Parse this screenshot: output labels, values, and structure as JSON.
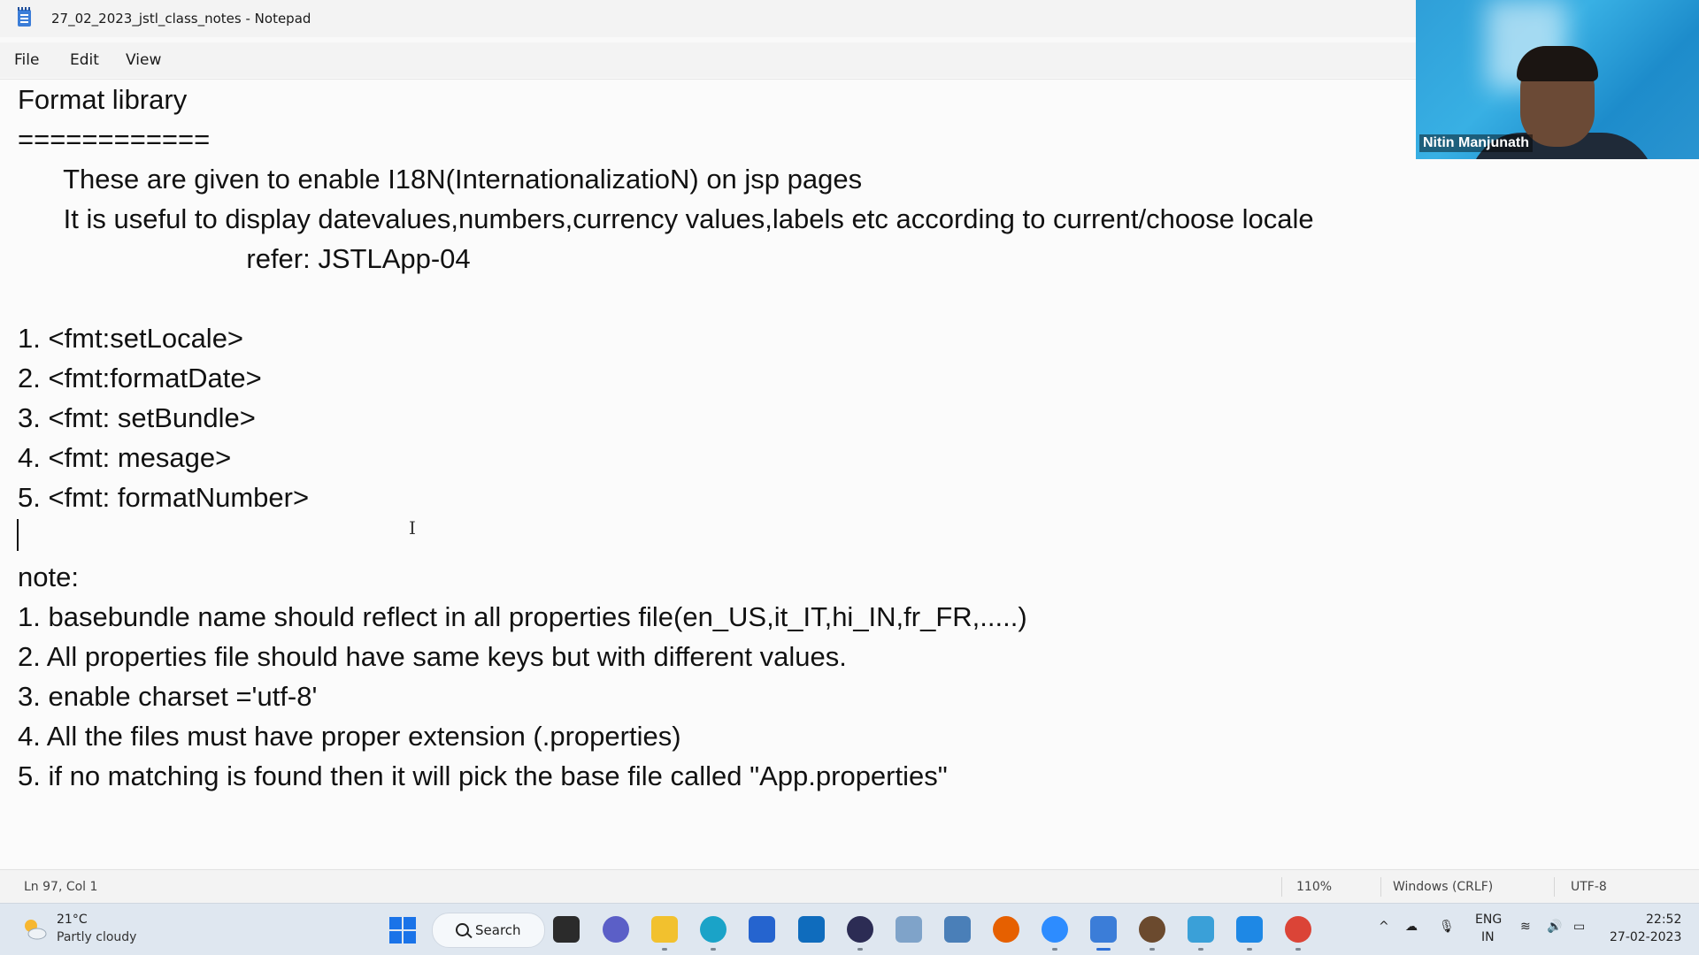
{
  "window": {
    "title": "27_02_2023_jstl_class_notes - Notepad"
  },
  "menu": {
    "file": "File",
    "edit": "Edit",
    "view": "View"
  },
  "editor": {
    "lines": [
      "Format library",
      "============",
      "      These are given to enable I18N(InternationalizatioN) on jsp pages",
      "      It is useful to display datevalues,numbers,currency values,labels etc according to current/choose locale",
      "                              refer: JSTLApp-04",
      "",
      "1. <fmt:setLocale>",
      "2. <fmt:formatDate>",
      "3. <fmt: setBundle>",
      "4. <fmt: mesage>",
      "5. <fmt: formatNumber>",
      "",
      "note:",
      "1. basebundle name should reflect in all properties file(en_US,it_IT,hi_IN,fr_FR,.....)",
      "2. All properties file should have same keys but with different values.",
      "3. enable charset ='utf-8'",
      "4. All the files must have proper extension (.properties)",
      "5. if no matching is found then it will pick the base file called \"App.properties\""
    ]
  },
  "status": {
    "position": "Ln 97, Col 1",
    "zoom": "110%",
    "line_ending": "Windows (CRLF)",
    "encoding": "UTF-8"
  },
  "webcam": {
    "name": "Nitin Manjunath"
  },
  "taskbar": {
    "weather_temp": "21°C",
    "weather_desc": "Partly cloudy",
    "search_label": "Search",
    "language_top": "ENG",
    "language_bottom": "IN",
    "time": "22:52",
    "date": "27-02-2023",
    "accent_color": "#2e6fd6"
  }
}
